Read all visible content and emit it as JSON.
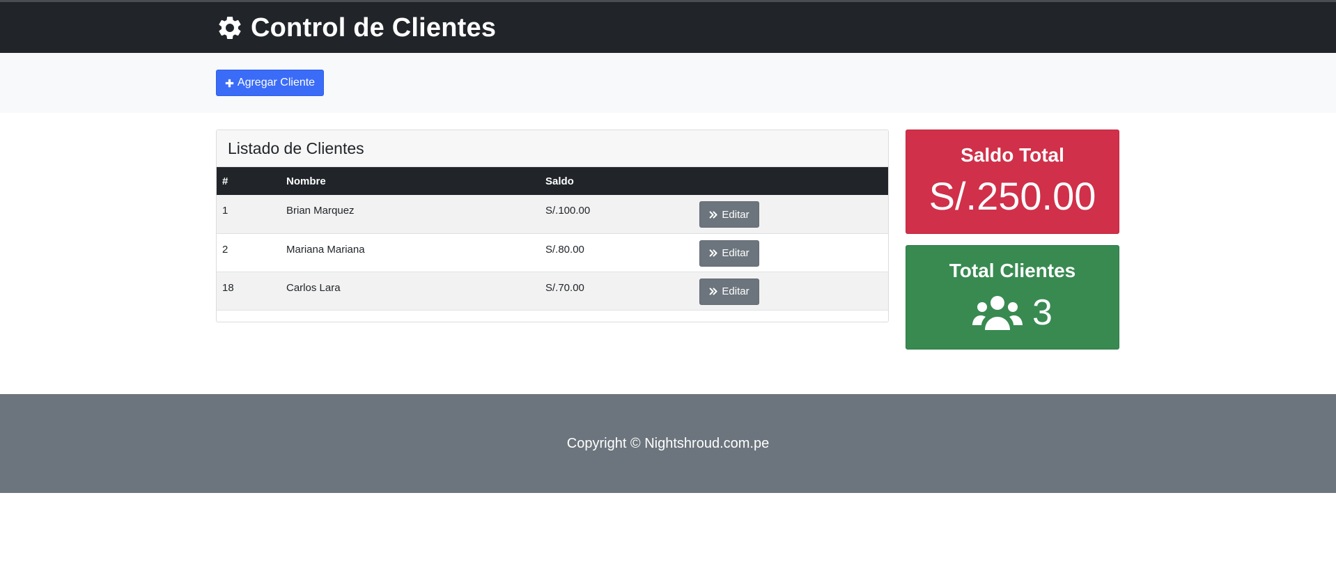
{
  "header": {
    "title": "Control de Clientes",
    "icon": "gear-icon"
  },
  "actions": {
    "add_label": "Agregar Cliente",
    "add_icon": "plus-icon"
  },
  "client_list": {
    "title": "Listado de Clientes",
    "columns": [
      "#",
      "Nombre",
      "Saldo",
      ""
    ],
    "rows": [
      {
        "id": "1",
        "nombre": "Brian Marquez",
        "saldo": "S/.100.00",
        "edit_label": "Editar"
      },
      {
        "id": "2",
        "nombre": "Mariana Mariana",
        "saldo": "S/.80.00",
        "edit_label": "Editar"
      },
      {
        "id": "18",
        "nombre": "Carlos Lara",
        "saldo": "S/.70.00",
        "edit_label": "Editar"
      }
    ]
  },
  "summary": {
    "saldo_total_title": "Saldo Total",
    "saldo_total_value": "S/.250.00",
    "total_clientes_title": "Total Clientes",
    "total_clientes_value": "3",
    "total_clientes_icon": "users-icon"
  },
  "footer": {
    "copyright": "Copyright © Nightshroud.com.pe"
  },
  "colors": {
    "header_bg": "#212529",
    "primary": "#3b6cf8",
    "secondary": "#6c757d",
    "danger": "#d03049",
    "success": "#388a51"
  }
}
